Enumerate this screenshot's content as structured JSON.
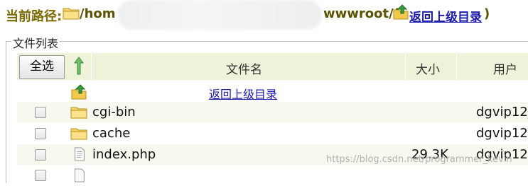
{
  "path": {
    "label": "当前路径:",
    "prefix": "/hom",
    "suffix": "wwwroot/(",
    "up_link": "返回上级目录",
    "close": ")"
  },
  "file_list": {
    "legend": "文件列表",
    "select_all_label": "全选",
    "columns": {
      "name": "文件名",
      "size": "大小",
      "user": "用户"
    },
    "up_link": "返回上级目录",
    "rows": [
      {
        "name": "cgi-bin",
        "size": "",
        "user": "dgvip12",
        "type": "folder"
      },
      {
        "name": "cache",
        "size": "",
        "user": "dgvip12",
        "type": "folder"
      },
      {
        "name": "index.php",
        "size": "29.3K",
        "user": "dgvip12",
        "type": "file"
      },
      {
        "name": "",
        "size": "",
        "user": "",
        "type": "file"
      }
    ]
  },
  "watermark": "https://blog.csdn.net/programmer_kevin",
  "colors": {
    "header_bg": "#eef2d9",
    "row_alt_bg": "#f7f9ee",
    "link": "#1a1aa8",
    "path_text": "#5a5200"
  },
  "icons": {
    "folder": "folder-icon",
    "file": "file-icon",
    "up": "up-folder-icon",
    "sort": "sort-arrow-icon"
  }
}
